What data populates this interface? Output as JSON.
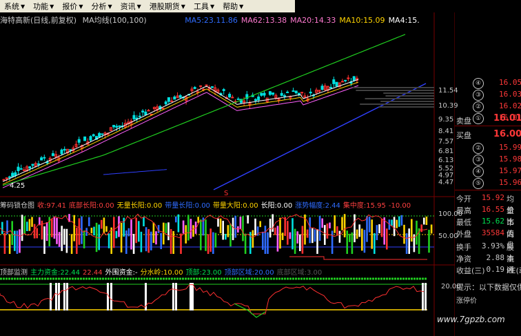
{
  "menu": [
    {
      "label": "系统",
      "arrow": "▼"
    },
    {
      "label": "功能",
      "arrow": "▼"
    },
    {
      "label": "报价",
      "arrow": "▼"
    },
    {
      "label": "分析",
      "arrow": "▼"
    },
    {
      "label": "资讯",
      "arrow": "▼"
    },
    {
      "label": "港股期货",
      "arrow": "▼"
    },
    {
      "label": "工具",
      "arrow": "▼"
    },
    {
      "label": "帮助",
      "arrow": "▼"
    }
  ],
  "chart_header": {
    "stock": "海特高新(日线,前复权)",
    "indicator": "MA均线(100,100)",
    "ma_labels": [
      {
        "text": "MA5:23.11.86",
        "color": "#2f6cff"
      },
      {
        "text": "MA62:13.38",
        "color": "#ff7ad0"
      },
      {
        "text": "MA20:14.33",
        "color": "#ff7ad0"
      },
      {
        "text": "MA10:15.09",
        "color": "#ffd400"
      },
      {
        "text": "MA4:15.",
        "color": "#ffffff"
      }
    ]
  },
  "price_axis": [
    "11.54",
    "10.39",
    "9.35",
    "8.41",
    "7.57",
    "6.81",
    "6.13",
    "5.52",
    "4.97",
    "4.47"
  ],
  "low_marker": "4.25",
  "order_book": {
    "sell": [
      {
        "num": "④",
        "price": "16.05"
      },
      {
        "num": "③",
        "price": "16.03"
      },
      {
        "num": "②",
        "price": "16.02"
      },
      {
        "num": "①",
        "price": "16.01"
      }
    ],
    "sell_label": "卖盘",
    "buy_label": "买盘",
    "buy_top": "16.00",
    "buy": [
      {
        "num": "②",
        "price": "15.99"
      },
      {
        "num": "③",
        "price": "15.98"
      },
      {
        "num": "④",
        "price": "15.97"
      },
      {
        "num": "⑤",
        "price": "15.96"
      }
    ]
  },
  "stats": [
    {
      "label": "今开",
      "value": "15.92",
      "label2": "均价",
      "color": "#ff3838"
    },
    {
      "label": "最高",
      "value": "16.55",
      "label2": "量比",
      "color": "#ff3838"
    },
    {
      "label": "最低",
      "value": "15.62",
      "label2": "市值",
      "color": "#00e050"
    },
    {
      "label": "外盘",
      "value": "35584",
      "label2": "内盘",
      "color": "#ff3838"
    },
    {
      "label": "换手",
      "value": "3.93%",
      "label2": "股本",
      "color": "#c8c8c8"
    },
    {
      "label": "净资",
      "value": "2.88",
      "label2": "流通",
      "color": "#c8c8c8"
    },
    {
      "label": "收益(三)",
      "value": "0.19",
      "label2": "PE(动",
      "color": "#c8c8c8"
    }
  ],
  "hint": "提示：以下数据仅供参",
  "hint2": "涨停价",
  "indicator1": {
    "name": "筹码锁仓图",
    "items": [
      {
        "text": "收:97.41",
        "color": "#ff4040"
      },
      {
        "text": "底部长阳:0.00",
        "color": "#ff4040"
      },
      {
        "text": "无量长阳:0.00",
        "color": "#ffd400"
      },
      {
        "text": "带量长阳:0.00",
        "color": "#2f6cff"
      },
      {
        "text": "带量大阳:0.00",
        "color": "#ffd400"
      },
      {
        "text": "长阳:0.00",
        "color": "#ffffff"
      },
      {
        "text": "涨势幅度:2.44",
        "color": "#2f6cff"
      },
      {
        "text": "集中度:15.95",
        "color": "#ff4040"
      },
      {
        "text": "-10.00",
        "color": "#ff4040"
      }
    ],
    "axis": [
      "100.00",
      "50.00"
    ]
  },
  "indicator2": {
    "name": "顶部监测",
    "items": [
      {
        "text": "主力资金:22.44",
        "color": "#00e050"
      },
      {
        "text": "22.44",
        "color": "#ff4040"
      },
      {
        "text": "外围资金:-",
        "color": "#ffffff"
      },
      {
        "text": "分水岭:10.00",
        "color": "#ffd400"
      },
      {
        "text": "顶部:23.00",
        "color": "#00e050"
      },
      {
        "text": "顶部区域:20.00",
        "color": "#2f6cff"
      },
      {
        "text": "底部区域:3.00",
        "color": "#555555"
      }
    ],
    "axis": [
      "20.00"
    ]
  },
  "watermark": "www.7gpzb.com",
  "colors": {
    "up": "#ff3030",
    "down": "#00e0e0",
    "ma_green": "#20d020",
    "ma_blue": "#2f40ff",
    "ma_pink": "#ff60ff",
    "ma_yellow": "#ffd400"
  }
}
